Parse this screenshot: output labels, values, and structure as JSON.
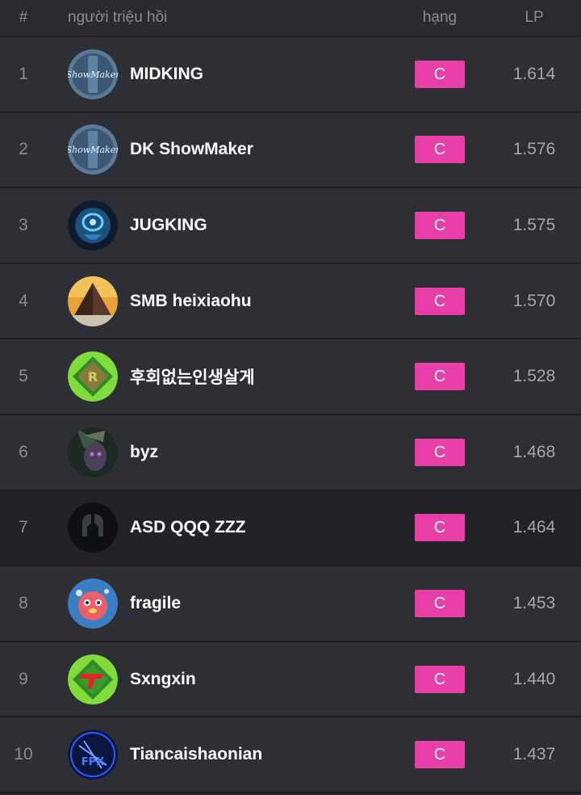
{
  "header": {
    "rank": "#",
    "summoner": "người triệu hồi",
    "tier": "hạng",
    "lp": "LP"
  },
  "colors": {
    "tier_badge": "#e83ea8",
    "row_bg": "#2e2f35",
    "highlight_row_bg": "#222327",
    "muted_text": "#8b8c92"
  },
  "rows": [
    {
      "rank": "1",
      "name": "MIDKING",
      "tier": "C",
      "lp": "1.614",
      "avatar_icon": "showmaker-logo-icon"
    },
    {
      "rank": "2",
      "name": "DK ShowMaker",
      "tier": "C",
      "lp": "1.576",
      "avatar_icon": "showmaker-logo-icon"
    },
    {
      "rank": "3",
      "name": "JUGKING",
      "tier": "C",
      "lp": "1.575",
      "avatar_icon": "blue-champion-icon"
    },
    {
      "rank": "4",
      "name": "SMB heixiaohu",
      "tier": "C",
      "lp": "1.570",
      "avatar_icon": "pyramid-icon"
    },
    {
      "rank": "5",
      "name": "후회없는인생살게",
      "tier": "C",
      "lp": "1.528",
      "avatar_icon": "rng-team-logo-icon"
    },
    {
      "rank": "6",
      "name": "byz",
      "tier": "C",
      "lp": "1.468",
      "avatar_icon": "dark-champion-icon"
    },
    {
      "rank": "7",
      "name": "ASD QQQ ZZZ",
      "tier": "C",
      "lp": "1.464",
      "avatar_icon": "helmet-icon"
    },
    {
      "rank": "8",
      "name": "fragile",
      "tier": "C",
      "lp": "1.453",
      "avatar_icon": "poro-icon"
    },
    {
      "rank": "9",
      "name": "Sxngxin",
      "tier": "C",
      "lp": "1.440",
      "avatar_icon": "t1-team-logo-icon"
    },
    {
      "rank": "10",
      "name": "Tiancaishaonian",
      "tier": "C",
      "lp": "1.437",
      "avatar_icon": "fpx-team-logo-icon"
    }
  ]
}
